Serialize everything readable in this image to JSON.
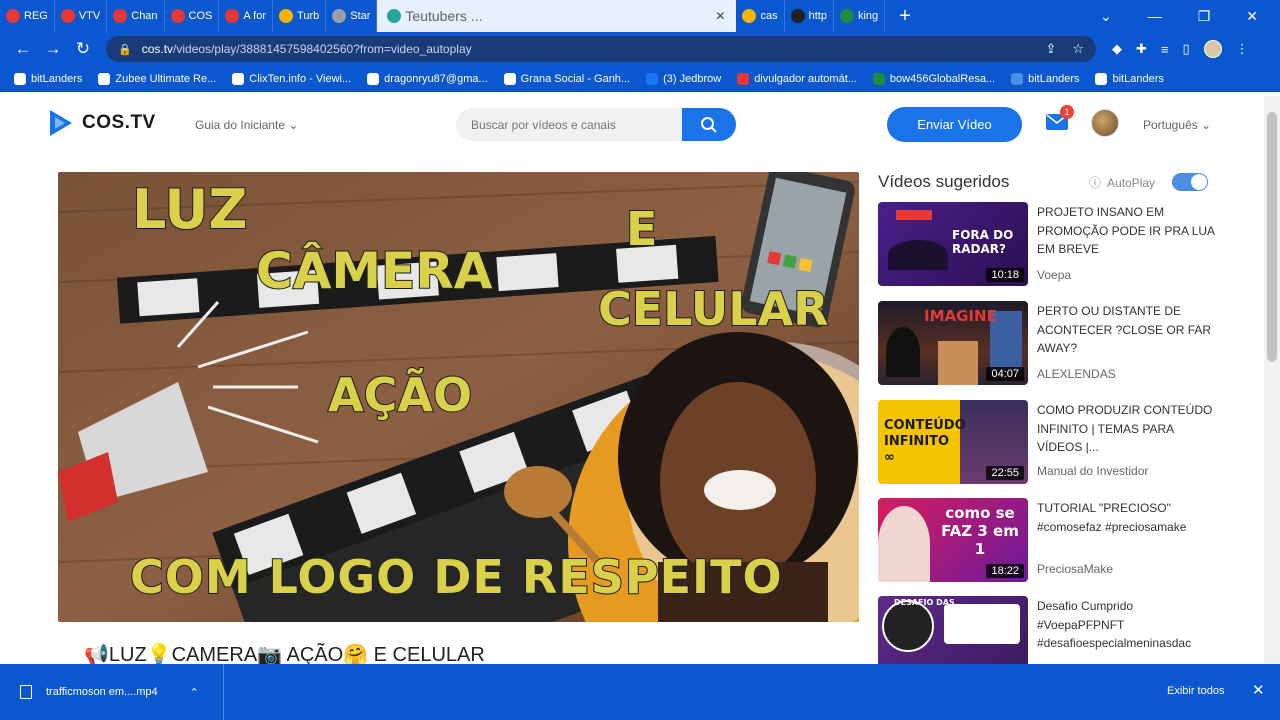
{
  "browser": {
    "tabs": [
      {
        "label": "REG",
        "color": "#e53935"
      },
      {
        "label": "VTV",
        "color": "#e53935"
      },
      {
        "label": "Chan",
        "color": "#e53935"
      },
      {
        "label": "COS",
        "color": "#e53935"
      },
      {
        "label": "A for",
        "color": "#e53935"
      },
      {
        "label": "Turb",
        "color": "#f5b400"
      },
      {
        "label": "Star",
        "color": "#9aa0a6"
      }
    ],
    "active_tab": {
      "label": "Teutubers ..."
    },
    "tabs_after": [
      {
        "label": "cas",
        "color": "#f5b400"
      },
      {
        "label": "http",
        "color": "#202124"
      },
      {
        "label": "king",
        "color": "#1e8e3e"
      }
    ],
    "url_host": "cos.tv",
    "url_path": "/videos/play/38881457598402560?from=video_autoplay",
    "bookmarks": [
      {
        "label": "bitLanders",
        "color": "#ffffff"
      },
      {
        "label": "Zubee Ultimate Re...",
        "color": "#ffffff"
      },
      {
        "label": "ClixTen.info - Viewi...",
        "color": "#ffffff"
      },
      {
        "label": "dragonryu87@gma...",
        "color": "#ffffff"
      },
      {
        "label": "Grana Social - Ganh...",
        "color": "#ffffff"
      },
      {
        "label": "(3) Jedbrow",
        "color": "#1877f2"
      },
      {
        "label": "divulgador automát...",
        "color": "#e53935"
      },
      {
        "label": "bow456GlobalResa...",
        "color": "#1e8e3e"
      },
      {
        "label": "bitLanders",
        "color": "#4a90e2"
      },
      {
        "label": "bitLanders",
        "color": "#ffffff"
      }
    ]
  },
  "site": {
    "logo_text": "COS.TV",
    "guide_label": "Guia do Iniciante",
    "search_placeholder": "Buscar por vídeos e canais",
    "upload_label": "Enviar Vídeo",
    "mail_count": "1",
    "language": "Português"
  },
  "video": {
    "thumb_lines": [
      "LUZ",
      "CÂMERA",
      "E",
      "CELULAR",
      "AÇÃO",
      "COM LOGO DE RESPEITO"
    ],
    "title": "📢LUZ💡CAMERA📷 AÇÃO🤗 E CELULAR"
  },
  "sidebar": {
    "title": "Vídeos sugeridos",
    "autoplay_label": "AutoPlay",
    "autoplay_on": true,
    "items": [
      {
        "title": "PROJETO INSANO EM PROMOÇÃO PODE IR PRA LUA EM BREVE",
        "channel": "Voepa",
        "duration": "10:18",
        "thumb_text": "FORA DO RADAR?",
        "thumb_bg": "#3b1f6b"
      },
      {
        "title": "PERTO OU DISTANTE DE ACONTECER ?CLOSE OR FAR AWAY?",
        "channel": "ALEXLENDAS",
        "duration": "04:07",
        "thumb_text": "IMAGINE",
        "thumb_bg": "#2a2430"
      },
      {
        "title": "COMO PRODUZIR CONTEÚDO INFINITO | TEMAS PARA VÍDEOS |...",
        "channel": "Manual do Investidor",
        "duration": "22:55",
        "thumb_text": "CONTEÚDO INFINITO ∞",
        "thumb_bg": "#f5c400"
      },
      {
        "title": "TUTORIAL \"PRECIOSO\" #comosefaz #preciosamake",
        "channel": "PreciosaMake",
        "duration": "18:22",
        "thumb_text": "como se FAZ 3 em 1",
        "thumb_bg": "#8e24aa"
      },
      {
        "title": "Desafio Cumprido #VoepaPFPNFT #desafioespecialmeninasdac",
        "channel": "",
        "duration": "",
        "thumb_text": "DESAFIO DAS",
        "thumb_bg": "#5e2a8c"
      }
    ]
  },
  "downloads": {
    "file_name": "trafficmoson em....mp4",
    "show_all_label": "Exibir todos"
  }
}
